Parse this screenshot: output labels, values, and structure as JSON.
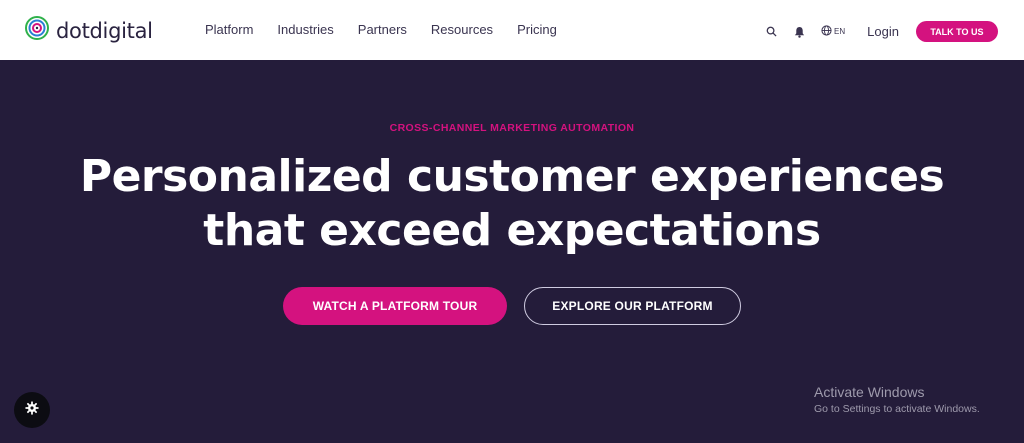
{
  "header": {
    "logo_text": "dotdigital",
    "nav": [
      "Platform",
      "Industries",
      "Partners",
      "Resources",
      "Pricing"
    ],
    "language": "EN",
    "login": "Login",
    "cta": "TALK TO US"
  },
  "hero": {
    "eyebrow": "CROSS-CHANNEL MARKETING AUTOMATION",
    "headline_line1": "Personalized customer experiences",
    "headline_line2": "that exceed expectations",
    "primary_button": "WATCH A PLATFORM TOUR",
    "secondary_button": "EXPLORE OUR PLATFORM"
  },
  "overlay": {
    "activate_title": "Activate Windows",
    "activate_sub": "Go to Settings to activate Windows."
  },
  "icons": {
    "logo": "concentric-rings-icon",
    "search": "search-icon",
    "bell": "bell-icon",
    "globe": "globe-icon",
    "settings": "gear-icon"
  },
  "colors": {
    "accent": "#d4127f",
    "hero_bg": "#241c3a",
    "header_bg": "#ffffff"
  }
}
